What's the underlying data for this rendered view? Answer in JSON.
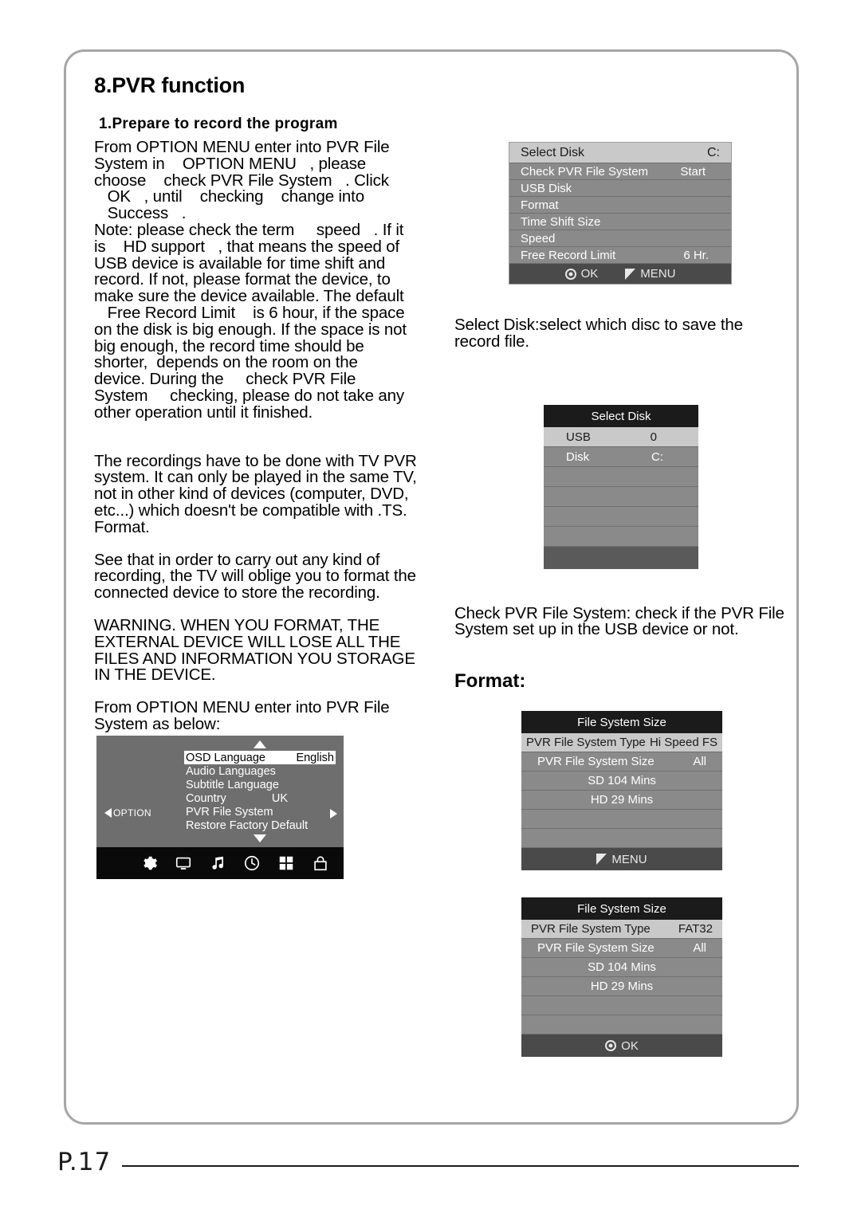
{
  "page": {
    "section_title": "8.PVR function",
    "sub_title": "1.Prepare to record the program",
    "page_number": "P.17"
  },
  "left_column": {
    "intro": "From OPTION MENU enter into PVR File\nSystem in    OPTION MENU   , please\nchoose    check PVR File System   . Click\n   OK   , until    checking    change into\n   Success   .\nNote: please check the term     speed   . If it\nis    HD support   , that means the speed of\nUSB device is available for time shift and\nrecord. If not, please format the device, to\nmake sure the device available. The default\n   Free Record Limit    is 6 hour, if the space\non the disk is big enough. If the space is not\nbig enough, the record time should be\nshorter,  depends on the room on the\ndevice. During the     check PVR File\nSystem     checking, please do not take any\nother operation until it finished.",
    "paragraph_recordings": "The recordings have to be done with TV PVR\nsystem. It can only be played in the same TV,\nnot in other kind of devices (computer, DVD,\netc...) which doesn't be compatible with .TS.\nFormat.",
    "paragraph_format_oblige": "See that in order to carry out any kind of\nrecording, the TV will oblige you to format the\nconnected device to store the recording.",
    "paragraph_warning": "WARNING. WHEN YOU FORMAT, THE\nEXTERNAL DEVICE WILL LOSE ALL THE\nFILES AND INFORMATION YOU STORAGE\nIN THE DEVICE.",
    "paragraph_from_option": "From OPTION MENU enter into PVR File\nSystem as below:"
  },
  "right_column": {
    "caption_select_disk": "Select Disk:select which disc to save the\nrecord file.",
    "caption_check_pvr": "Check PVR File System: check if the PVR File\nSystem set up in the USB device or not.",
    "format_title": "Format:"
  },
  "pvr_panel": {
    "header": {
      "label": "Select Disk",
      "value": "C:"
    },
    "rows": [
      {
        "label": "Check PVR File System",
        "value": "Start"
      },
      {
        "label": "USB Disk",
        "value": ""
      },
      {
        "label": "Format",
        "value": ""
      },
      {
        "label": "Time Shift Size",
        "value": ""
      },
      {
        "label": "Speed",
        "value": ""
      },
      {
        "label": "Free Record Limit",
        "value": "6 Hr."
      }
    ],
    "footer": {
      "ok": "OK",
      "menu": "MENU"
    }
  },
  "select_disk_popup": {
    "title": "Select Disk",
    "rows": [
      {
        "label": "USB",
        "value": "0",
        "highlight": true
      },
      {
        "label": "Disk",
        "value": "C:",
        "highlight": false
      },
      {
        "label": "",
        "value": "",
        "highlight": false
      },
      {
        "label": "",
        "value": "",
        "highlight": false
      },
      {
        "label": "",
        "value": "",
        "highlight": false
      },
      {
        "label": "",
        "value": "",
        "highlight": false
      }
    ]
  },
  "file_system_size_1": {
    "title": "File System Size",
    "rows": [
      {
        "label": "PVR File System Type",
        "value": "Hi Speed FS"
      },
      {
        "label": "PVR File System Size",
        "value": "All"
      },
      {
        "label": "SD  104  Mins",
        "value": ""
      },
      {
        "label": "HD  29  Mins",
        "value": ""
      },
      {
        "label": "",
        "value": ""
      },
      {
        "label": "",
        "value": ""
      }
    ],
    "footer": {
      "menu": "MENU"
    }
  },
  "file_system_size_2": {
    "title": "File System Size",
    "rows": [
      {
        "label": "PVR File System Type",
        "value": "FAT32"
      },
      {
        "label": "PVR File System Size",
        "value": "All"
      },
      {
        "label": "SD  104  Mins",
        "value": ""
      },
      {
        "label": "HD  29  Mins",
        "value": ""
      },
      {
        "label": "",
        "value": ""
      },
      {
        "label": "",
        "value": ""
      }
    ],
    "footer": {
      "ok": "OK"
    }
  },
  "osd_menu": {
    "side_tag": "OPTION",
    "items": [
      {
        "label": "OSD Language",
        "value": "English",
        "selected": true
      },
      {
        "label": "Audio Languages",
        "value": "",
        "selected": false
      },
      {
        "label": "Subtitle Language",
        "value": "",
        "selected": false
      },
      {
        "label": "Country",
        "value": "UK",
        "selected": false
      },
      {
        "label": "PVR File System",
        "value": "",
        "selected": false
      },
      {
        "label": "Restore Factory Default",
        "value": "",
        "selected": false
      }
    ],
    "icons": [
      "gear-icon",
      "monitor-icon",
      "music-note-icon",
      "clock-icon",
      "grid-icon",
      "lock-icon"
    ]
  },
  "colors": {
    "panel_row": "#8a8a8a",
    "panel_highlight": "#c9c9c9",
    "panel_titlebar": "#1b1b1b",
    "panel_footer": "#4a4a4a",
    "osd_background": "#6e6e6e",
    "border": "#a6a6a6"
  }
}
